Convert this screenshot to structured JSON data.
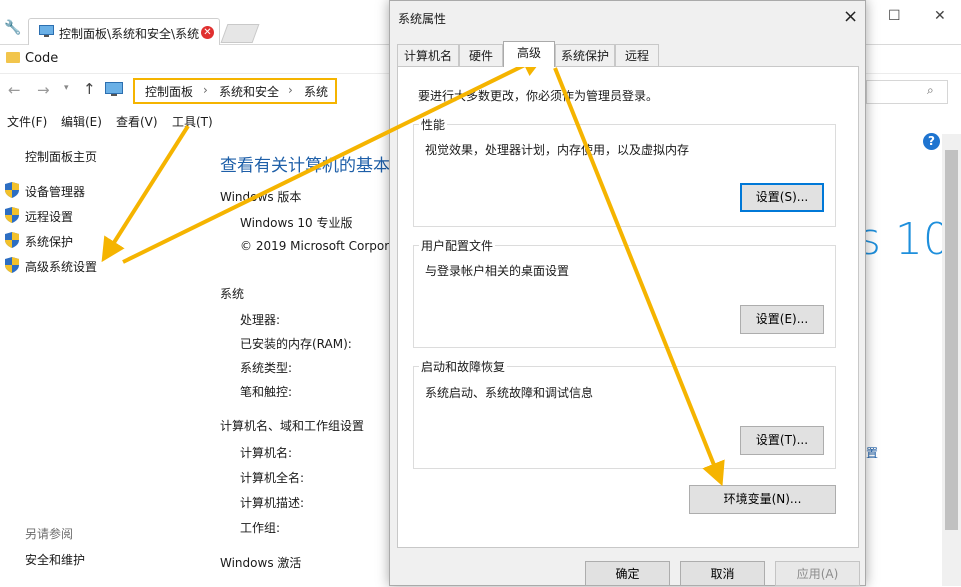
{
  "browser": {
    "tab_title": "控制面板\\系统和安全\\系统",
    "bookmark": "Code"
  },
  "breadcrumb": [
    "控制面板",
    "系统和安全",
    "系统"
  ],
  "menu": [
    "文件(F)",
    "编辑(E)",
    "查看(V)",
    "工具(T)"
  ],
  "left_pane": {
    "home": "控制面板主页",
    "links": [
      "设备管理器",
      "远程设置",
      "系统保护",
      "高级系统设置"
    ],
    "see_also_title": "另请参阅",
    "see_also_link": "安全和维护"
  },
  "main": {
    "title": "查看有关计算机的基本信",
    "edition_section": "Windows 版本",
    "edition": "Windows 10 专业版",
    "copyright": "© 2019 Microsoft Corpor",
    "system_section": "系统",
    "system_labels": [
      "处理器:",
      "已安装的内存(RAM):",
      "系统类型:",
      "笔和触控:"
    ],
    "computer_section": "计算机名、域和工作组设置",
    "computer_labels": [
      "计算机名:",
      "计算机全名:",
      "计算机描述:",
      "工作组:"
    ],
    "change_settings_fragment": "置",
    "activation_section": "Windows 激活",
    "win10_logo_text": "s 10"
  },
  "dialog": {
    "title": "系统属性",
    "close": "×",
    "tabs": [
      "计算机名",
      "硬件",
      "高级",
      "系统保护",
      "远程"
    ],
    "active_tab": "高级",
    "admin_note": "要进行大多数更改，你必须作为管理员登录。",
    "perf_title": "性能",
    "perf_desc": "视觉效果，处理器计划，内存使用，以及虚拟内存",
    "perf_btn": "设置(S)...",
    "profile_title": "用户配置文件",
    "profile_desc": "与登录帐户相关的桌面设置",
    "profile_btn": "设置(E)...",
    "startup_title": "启动和故障恢复",
    "startup_desc": "系统启动、系统故障和调试信息",
    "startup_btn": "设置(T)...",
    "env_btn": "环境变量(N)...",
    "ok": "确定",
    "cancel": "取消",
    "apply": "应用(A)"
  },
  "colors": {
    "highlight": "#f5b400",
    "link": "#1e5fa8",
    "win10_blue": "#1e8fdc"
  }
}
